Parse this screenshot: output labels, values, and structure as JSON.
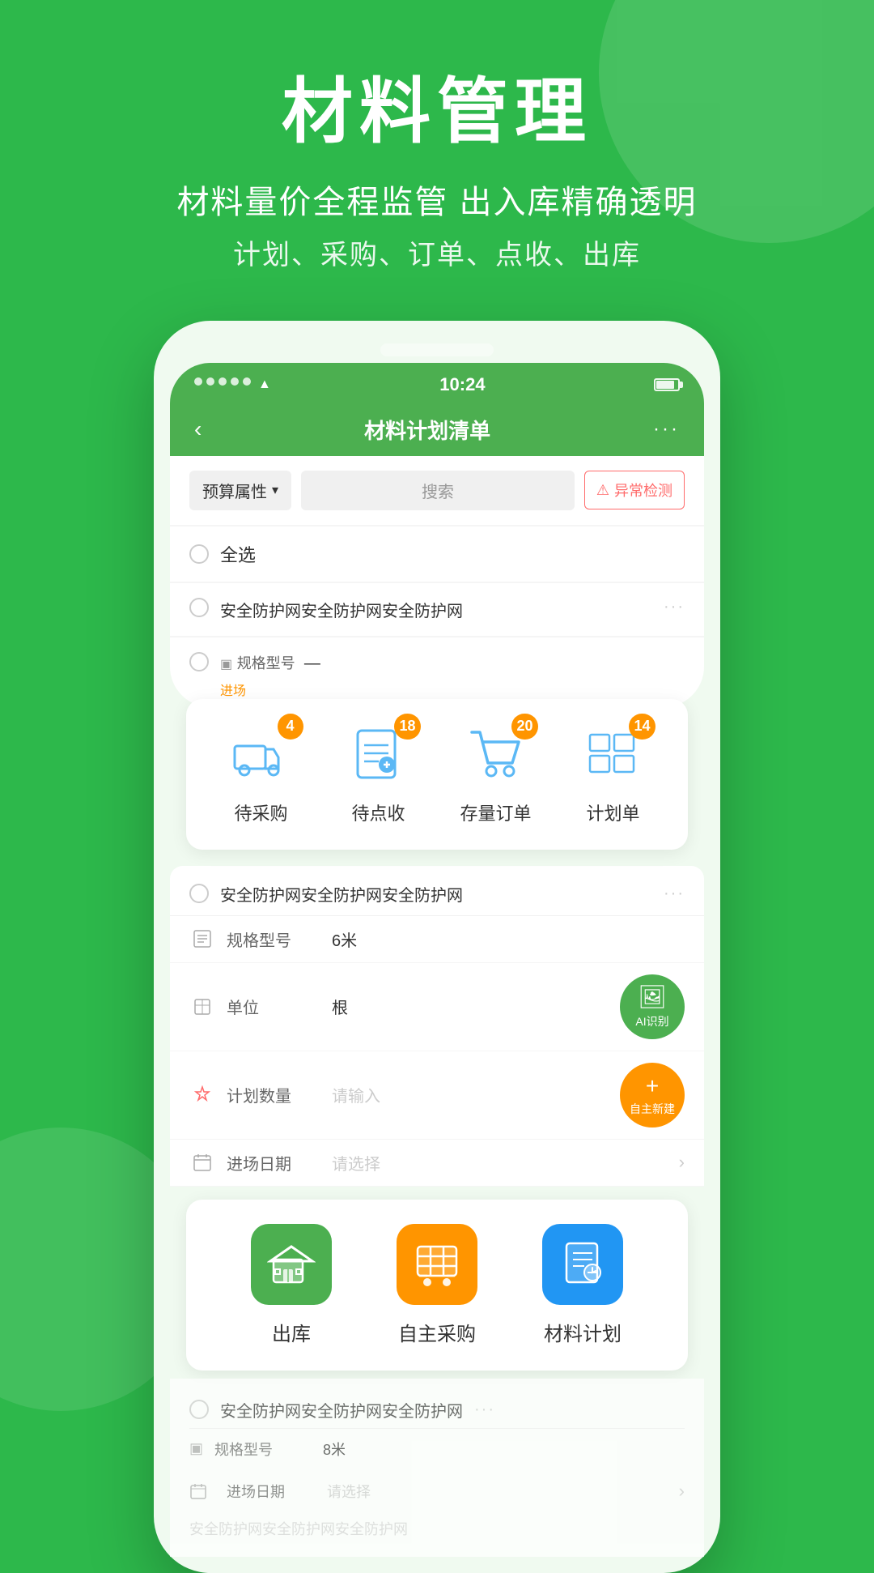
{
  "page": {
    "background_color": "#2db84b"
  },
  "header": {
    "main_title": "材料管理",
    "subtitle1": "材料量价全程监管  出入库精确透明",
    "subtitle2": "计划、采购、订单、点收、出库"
  },
  "phone": {
    "status": {
      "time": "10:24",
      "signal_dots": 5
    },
    "nav": {
      "back": "‹",
      "title": "材料计划清单",
      "more": "···"
    },
    "search": {
      "filter_label": "预算属性",
      "search_placeholder": "搜索",
      "anomaly_label": "异常检测"
    },
    "list": {
      "select_all": "全选",
      "items": [
        {
          "name": "安全防护网安全防护网安全防护网",
          "tag": ""
        },
        {
          "name": "安全防护网安全防护网安全防护网",
          "tag": ""
        }
      ]
    }
  },
  "quick_panel": {
    "items": [
      {
        "label": "待采购",
        "badge": "4",
        "icon_type": "truck"
      },
      {
        "label": "待点收",
        "badge": "18",
        "icon_type": "doc"
      },
      {
        "label": "存量订单",
        "badge": "20",
        "icon_type": "cart"
      },
      {
        "label": "计划单",
        "badge": "14",
        "icon_type": "grid"
      }
    ]
  },
  "detail": {
    "item_name": "安全防护网安全防护网安全防护网",
    "fields": [
      {
        "label": "规格型号",
        "value": "6米",
        "icon": "spec"
      },
      {
        "label": "单位",
        "value": "根",
        "icon": "unit",
        "has_ai": true
      },
      {
        "label": "计划数量",
        "value": "请输入",
        "is_placeholder": true,
        "icon": "qty",
        "has_new": true
      },
      {
        "label": "进场日期",
        "value": "请选择",
        "is_placeholder": true,
        "icon": "date",
        "has_chevron": true
      }
    ]
  },
  "bottom_panel": {
    "items": [
      {
        "label": "出库",
        "icon_color": "green",
        "icon_type": "warehouse"
      },
      {
        "label": "自主采购",
        "icon_color": "orange",
        "icon_type": "shop-cart"
      },
      {
        "label": "材料计划",
        "icon_color": "blue",
        "icon_type": "plan-doc"
      }
    ]
  },
  "second_detail": {
    "item_name": "安全防护网安全防护网安全防护网",
    "spec": "8米",
    "fields": [
      {
        "label": "进场日期",
        "value": "请选择"
      }
    ]
  }
}
